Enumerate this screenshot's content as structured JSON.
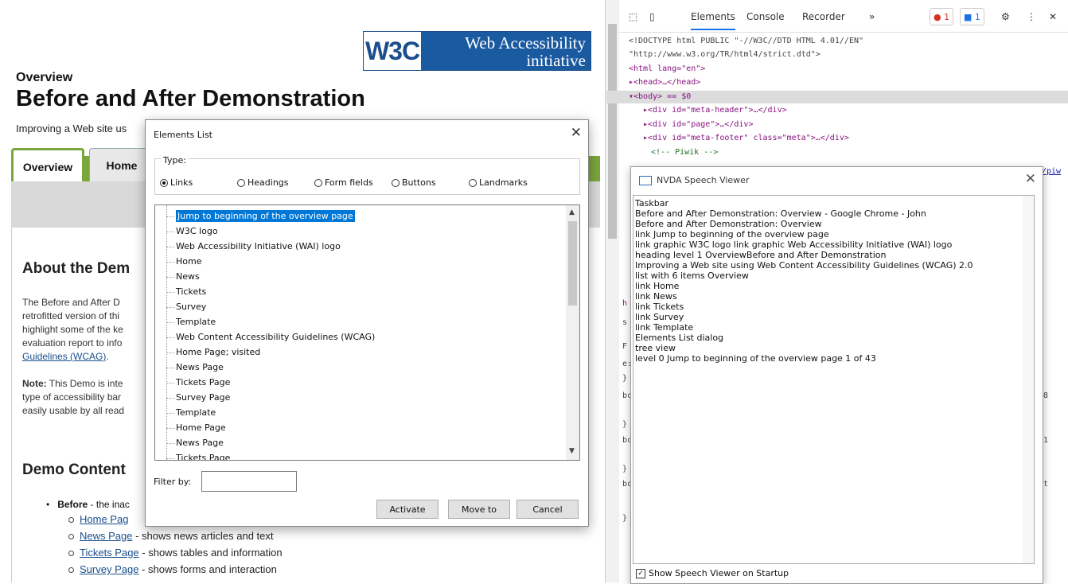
{
  "page": {
    "logo_w3c": "W3C",
    "logo_wai_line1": "Web Accessibility",
    "logo_wai_line2": "initiative",
    "overview_label": "Overview",
    "title": "Before and After Demonstration",
    "subtitle": "Improving a Web site us",
    "tabs": [
      "Overview",
      "Home"
    ],
    "about_heading": "About the Dem",
    "paragraph1": [
      "The Before and After D",
      "retrofitted version of thi",
      "highlight some of the ke",
      "evaluation report to info"
    ],
    "paragraph1_link": "Guidelines (WCAG)",
    "paragraph1_tail": ".",
    "note_bold": "Note:",
    "note_text": [
      "This Demo is inte",
      "type of accessibility bar",
      "easily usable by all read"
    ],
    "demo_heading": "Demo Content",
    "bullet_bold": "Before",
    "bullet_text": " - the inac",
    "sub_items": [
      {
        "link": "Home Pag",
        "text": ""
      },
      {
        "link": "News Page",
        "text": " - shows news articles and text"
      },
      {
        "link": "Tickets Page",
        "text": " - shows tables and information"
      },
      {
        "link": "Survey Page",
        "text": " - shows forms and interaction"
      }
    ]
  },
  "dialog": {
    "title": "Elements List",
    "close": "✕",
    "type_label": "Type:",
    "radios": [
      "Links",
      "Headings",
      "Form fields",
      "Buttons",
      "Landmarks"
    ],
    "selected_radio": "Links",
    "items": [
      "Jump to beginning of the overview page",
      "W3C logo",
      "Web Accessibility Initiative (WAI) logo",
      "Home",
      "News",
      "Tickets",
      "Survey",
      "Template",
      "Web Content Accessibility Guidelines (WCAG)",
      "Home Page; visited",
      "News Page",
      "Tickets Page",
      "Survey Page",
      "Template",
      "Home Page",
      "News Page",
      "Tickets Page"
    ],
    "filter_label": "Filter by:",
    "filter_value": "",
    "buttons": {
      "activate": "Activate",
      "move_to": "Move to",
      "cancel": "Cancel"
    }
  },
  "devtools": {
    "tabs": [
      "Elements",
      "Console",
      "Recorder",
      "»"
    ],
    "active_tab": "Elements",
    "errors_count": "1",
    "messages_count": "1",
    "code_lines": [
      {
        "text": "<!DOCTYPE html PUBLIC \"-//W3C//DTD HTML 4.01//EN\""
      },
      {
        "text": "\"http://www.w3.org/TR/html4/strict.dtd\">"
      },
      {
        "text": "<html lang=\"en\">"
      },
      {
        "text": "▸<head>…</head>"
      },
      {
        "text": "▾<body> == $0"
      },
      {
        "text": "▸<div id=\"meta-header\">…</div>"
      },
      {
        "text": "▸<div id=\"page\">…</div>"
      },
      {
        "text": "▸<div id=\"meta-footer\" class=\"meta\">…</div>"
      },
      {
        "text": "<!-- Piwik -->"
      }
    ],
    "side_fragments": [
      "/piw",
      "h",
      "s",
      "F",
      "e:",
      "}",
      "bc",
      "}",
      "bc",
      "}",
      "bc",
      "}",
      "8",
      "1",
      "t"
    ]
  },
  "nvda": {
    "title": "NVDA Speech Viewer",
    "close": "✕",
    "lines": [
      "Taskbar",
      "Before and After Demonstration: Overview - Google Chrome - John",
      "Before and After Demonstration: Overview",
      "link   Jump to beginning of the overview page",
      "link   graphic   W3C logo  link   graphic   Web Accessibility Initiative (WAI) logo",
      "heading   level 1  OverviewBefore and After Demonstration",
      "Improving a Web site using Web Content Accessibility Guidelines (WCAG) 2.0",
      "list  with 6 items  Overview",
      "link   Home",
      "link   News",
      "link   Tickets",
      "link   Survey",
      "link   Template",
      "Elements List  dialog",
      "tree view",
      "level 0  Jump to beginning of the overview page  1 of 43"
    ],
    "startup_checkbox": "Show Speech Viewer on Startup",
    "startup_checked": true
  },
  "colors": {
    "accent_green": "#7aa63b",
    "w3c_blue": "#1a5aa0",
    "selection": "#0078d7",
    "devtools_blue": "#1a73e8"
  }
}
